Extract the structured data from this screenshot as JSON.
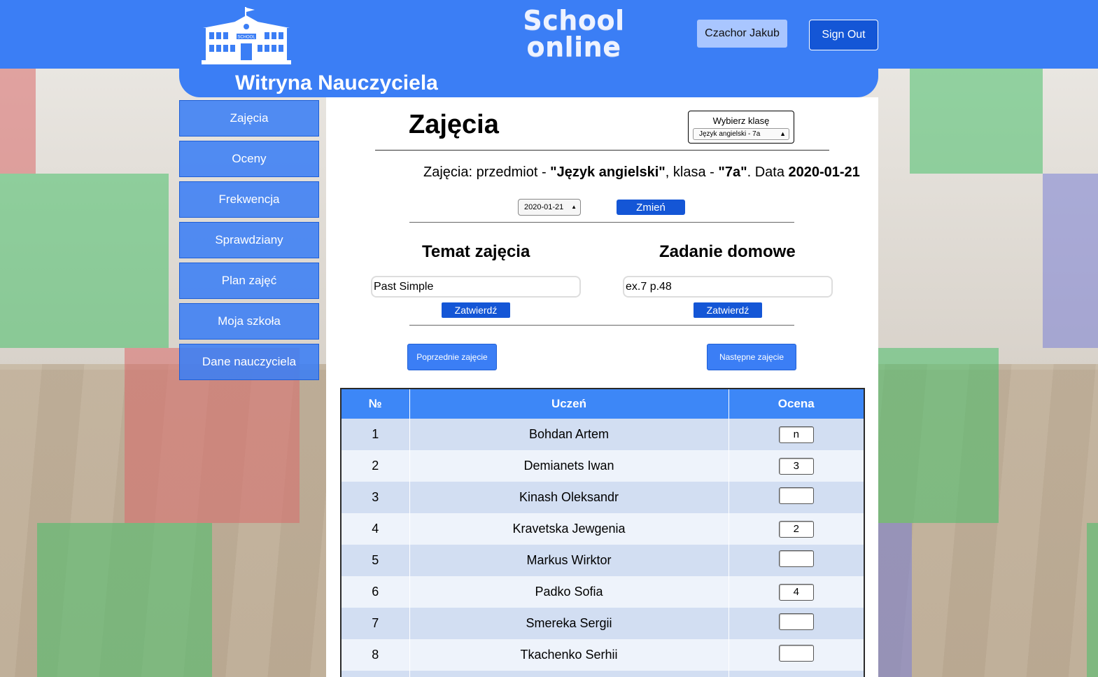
{
  "header": {
    "brand_line1": "School",
    "brand_line2": "online",
    "logo_text": "SCHOOL",
    "user_name": "Czachor Jakub",
    "sign_out": "Sign Out"
  },
  "subheader": {
    "title": "Witryna Nauczyciela"
  },
  "sidebar": {
    "items": [
      {
        "label": "Zajęcia"
      },
      {
        "label": "Oceny"
      },
      {
        "label": "Frekwencja"
      },
      {
        "label": "Sprawdziany"
      },
      {
        "label": "Plan zajęć"
      },
      {
        "label": "Moja szkoła"
      },
      {
        "label": "Dane nauczyciela"
      }
    ]
  },
  "main": {
    "title": "Zajęcia",
    "class_picker": {
      "label": "Wybierz klasę",
      "selected": "Język angielski - 7a"
    },
    "info": {
      "prefix": "Zajęcia: przedmiot - ",
      "subject": "\"Język angielski\"",
      "mid": ", klasa - ",
      "class": "\"7a\"",
      "date_prefix": ". Data ",
      "date": "2020-01-21"
    },
    "date_select": "2020-01-21",
    "change_button": "Zmień",
    "topic": {
      "heading": "Temat zajęcia",
      "value": "Past Simple",
      "confirm": "Zatwierdź"
    },
    "homework": {
      "heading": "Zadanie domowe",
      "value": "ex.7 p.48",
      "confirm": "Zatwierdź"
    },
    "prev_button": "Poprzednie zajęcie",
    "next_button": "Następne zajęcie"
  },
  "table": {
    "headers": [
      "№",
      "Uczeń",
      "Ocena"
    ],
    "rows": [
      {
        "no": "1",
        "name": "Bohdan Artem",
        "grade": "n"
      },
      {
        "no": "2",
        "name": "Demianets Iwan",
        "grade": "3"
      },
      {
        "no": "3",
        "name": "Kinash Oleksandr",
        "grade": ""
      },
      {
        "no": "4",
        "name": "Kravetska Jewgenia",
        "grade": "2"
      },
      {
        "no": "5",
        "name": "Markus Wirktor",
        "grade": ""
      },
      {
        "no": "6",
        "name": "Padko Sofia",
        "grade": "4"
      },
      {
        "no": "7",
        "name": "Smereka Sergii",
        "grade": ""
      },
      {
        "no": "8",
        "name": "Tkachenko Serhii",
        "grade": ""
      }
    ]
  },
  "colors": {
    "primary": "#3b7ef5",
    "dark_button": "#1456d6",
    "user_button": "#a9c6ff"
  }
}
